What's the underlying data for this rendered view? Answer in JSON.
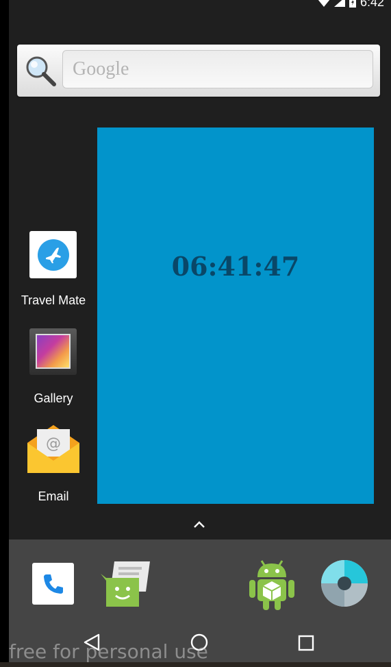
{
  "status_bar": {
    "time": "6:42",
    "icons": [
      "wifi-icon",
      "signal-icon",
      "battery-icon"
    ]
  },
  "search": {
    "placeholder": "Google",
    "icon": "magnifier-icon"
  },
  "clock": {
    "time": "06:41:47",
    "background": "#0294cb",
    "text_color": "#094768"
  },
  "apps": [
    {
      "label": "Travel Mate",
      "icon": "airplane-icon"
    },
    {
      "label": "Gallery",
      "icon": "gallery-icon"
    },
    {
      "label": "Email",
      "icon": "email-envelope-icon"
    }
  ],
  "dock": [
    "phone-icon",
    "messaging-icon",
    "android-apk-icon",
    "camera-shutter-icon"
  ],
  "nav": [
    "back-icon",
    "home-icon",
    "recents-icon"
  ],
  "watermark": "free for personal use",
  "colors": {
    "background": "#1f1f1f",
    "dock": "#454545",
    "accent": "#0294cb"
  }
}
